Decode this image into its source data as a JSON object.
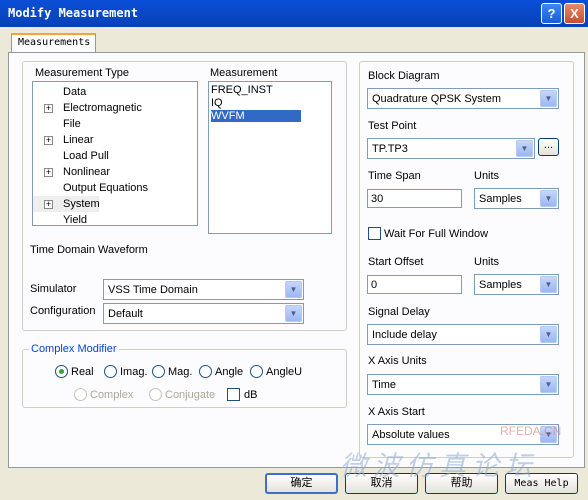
{
  "window": {
    "title": "Modify Measurement",
    "help_glyph": "?",
    "close_glyph": "X"
  },
  "tab": {
    "label": "Measurements"
  },
  "measurement_type": {
    "label": "Measurement Type",
    "items": [
      {
        "label": "Data",
        "expandable": false
      },
      {
        "label": "Electromagnetic",
        "expandable": true
      },
      {
        "label": "File",
        "expandable": false
      },
      {
        "label": "Linear",
        "expandable": true
      },
      {
        "label": "Load Pull",
        "expandable": false
      },
      {
        "label": "Nonlinear",
        "expandable": true
      },
      {
        "label": "Output Equations",
        "expandable": false
      },
      {
        "label": "System",
        "expandable": true
      },
      {
        "label": "Yield",
        "expandable": false
      }
    ]
  },
  "measurement": {
    "label": "Measurement",
    "items": [
      "FREQ_INST",
      "IQ",
      "WVFM"
    ],
    "selected": "WVFM"
  },
  "description": "Time Domain Waveform",
  "simulator": {
    "label": "Simulator",
    "value": "VSS Time Domain"
  },
  "configuration": {
    "label": "Configuration",
    "value": "Default"
  },
  "complex_modifier": {
    "label": "Complex Modifier",
    "options": [
      "Real",
      "Imag.",
      "Mag.",
      "Angle",
      "AngleU"
    ],
    "selected": "Real",
    "disabled_options": [
      "Complex",
      "Conjugate"
    ],
    "db_label": "dB"
  },
  "right": {
    "block_diagram": {
      "label": "Block Diagram",
      "value": "Quadrature QPSK System"
    },
    "test_point": {
      "label": "Test Point",
      "value": "TP.TP3",
      "browse": "..."
    },
    "time_span": {
      "label": "Time Span",
      "value": "30",
      "units_label": "Units",
      "units": "Samples"
    },
    "wait_full_window": {
      "label": "Wait For Full Window"
    },
    "start_offset": {
      "label": "Start Offset",
      "value": "0",
      "units_label": "Units",
      "units": "Samples"
    },
    "signal_delay": {
      "label": "Signal Delay",
      "value": "Include delay"
    },
    "x_axis_units": {
      "label": "X Axis Units",
      "value": "Time"
    },
    "x_axis_start": {
      "label": "X Axis Start",
      "value": "Absolute values"
    }
  },
  "buttons": {
    "ok": "确定",
    "cancel": "取消",
    "help": "帮助",
    "meas_help": "Meas Help"
  },
  "watermark": {
    "logo": "RFEDA.CN",
    "text": "微波仿真论坛"
  }
}
